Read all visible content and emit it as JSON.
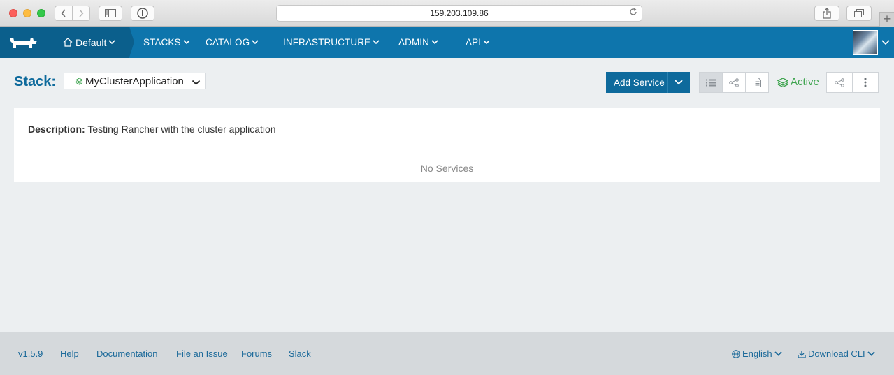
{
  "browser": {
    "url": "159.203.109.86"
  },
  "nav": {
    "environment": "Default",
    "items": [
      {
        "label": "STACKS"
      },
      {
        "label": "CATALOG"
      },
      {
        "label": "INFRASTRUCTURE"
      },
      {
        "label": "ADMIN"
      },
      {
        "label": "API"
      }
    ]
  },
  "stack": {
    "label": "Stack:",
    "selected": "MyClusterApplication",
    "add_service_label": "Add Service",
    "state": "Active"
  },
  "panel": {
    "description_label": "Description:",
    "description_text": "Testing Rancher with the cluster application",
    "empty_text": "No Services"
  },
  "footer": {
    "version": "v1.5.9",
    "links": [
      "Help",
      "Documentation",
      "File an Issue",
      "Forums",
      "Slack"
    ],
    "language": "English",
    "download_cli": "Download CLI"
  },
  "colors": {
    "nav_bg": "#0e75ac",
    "nav_env_bg": "#0b5f8c",
    "primary": "#0e6a9c",
    "active_green": "#3ca34d",
    "page_bg": "#eceff1",
    "footer_bg": "#d5d9dc"
  },
  "icons": [
    "home-icon",
    "layers-icon",
    "list-view-icon",
    "graph-view-icon",
    "file-view-icon",
    "share-icon",
    "more-vertical-icon",
    "globe-icon",
    "download-icon",
    "chevron-down-icon",
    "rancher-logo"
  ]
}
